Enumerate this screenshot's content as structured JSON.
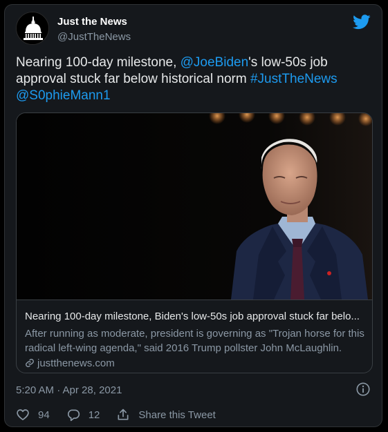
{
  "author": {
    "name": "Just the News",
    "handle": "@JustTheNews"
  },
  "tweet": {
    "text_parts": {
      "p1": "Nearing 100-day milestone, ",
      "mention1": "@JoeBiden",
      "p2": "'s low-50s job approval stuck far below historical norm ",
      "hashtag": "#JustTheNews",
      "mention2": "@S0phieMann1"
    }
  },
  "card": {
    "title": "Nearing 100-day milestone, Biden's low-50s job approval stuck far belo...",
    "description": "After running as moderate, president is governing as \"Trojan horse for this radical left-wing agenda,\" said 2016 Trump pollster John McLaughlin.",
    "domain": "justthenews.com",
    "link_icon": "link-icon"
  },
  "meta": {
    "timestamp": "5:20 AM · Apr 28, 2021",
    "info_icon": "info-icon"
  },
  "actions": {
    "likes": "94",
    "replies": "12",
    "share_label": "Share this Tweet"
  },
  "colors": {
    "background": "#15181c",
    "text": "#e7e9ea",
    "secondary": "#8b98a5",
    "link": "#1d9bf0",
    "border": "#2f3336"
  }
}
